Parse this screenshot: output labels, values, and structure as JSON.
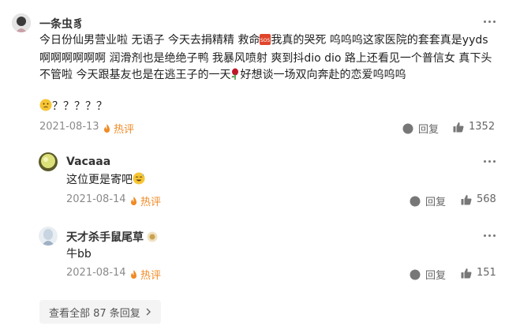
{
  "comments": [
    {
      "username": "一条虫豸",
      "text_segments": [
        "今日份仙男营业啦 无语子 今天去捐精精 救命",
        "我真的哭死 呜呜呜这家医院的套套真是yyds 啊啊啊啊啊啊 润滑剂也是绝绝子鸭 我暴风喷射 爽到抖dio dio 路上还看见一个普信女 真下头 不管啦 今天跟基友也是在逃王子的一天",
        "好想谈一场双向奔赴的恋爱呜呜呜",
        "？？？？？"
      ],
      "date": "2021-08-13",
      "hot_label": "热评",
      "reply_label": "回复",
      "likes": "1352"
    },
    {
      "username": "Vacaaa",
      "text": "这位更是寄吧",
      "date": "2021-08-14",
      "hot_label": "热评",
      "reply_label": "回复",
      "likes": "568"
    },
    {
      "username": "天才杀手鼠尾草",
      "text": "牛bb",
      "date": "2021-08-14",
      "hot_label": "热评",
      "reply_label": "回复",
      "likes": "151"
    }
  ],
  "view_all": "查看全部 87 条回复",
  "colors": {
    "hot": "#f08a24",
    "meta": "#8a8a8a",
    "button_bg": "#f4f4f4"
  }
}
